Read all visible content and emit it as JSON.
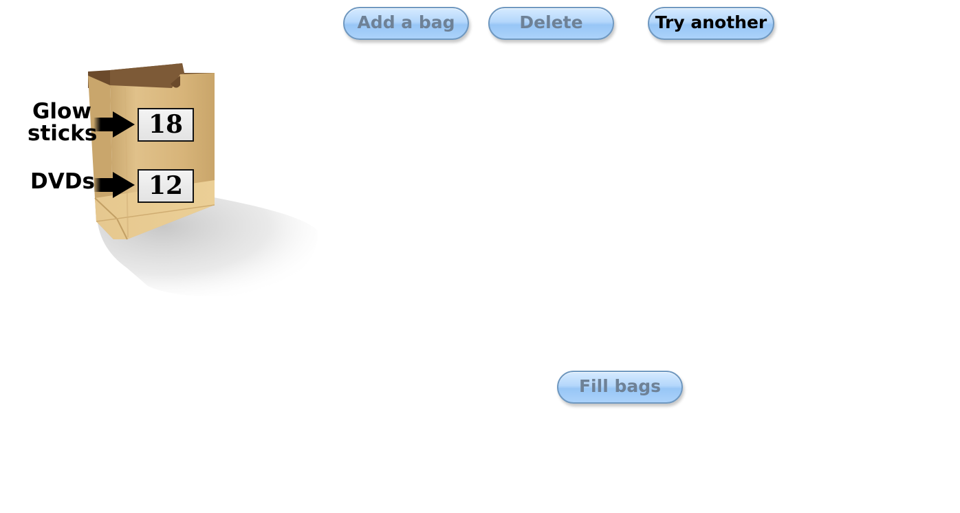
{
  "toolbar": {
    "add_label": "Add a bag",
    "delete_label": "Delete",
    "try_label": "Try another"
  },
  "bag": {
    "items": [
      {
        "label_line1": "Glow",
        "label_line2": "sticks",
        "count": "18"
      },
      {
        "label": "DVDs",
        "count": "12"
      }
    ],
    "colors": {
      "bag_front": "#d9b77a",
      "bag_side": "#c9a66c",
      "bag_inner": "#6b4a2b",
      "arrow": "#000000"
    }
  },
  "actions": {
    "fill_label": "Fill bags"
  },
  "colors": {
    "button_fill": "#b4d7fb",
    "button_border": "#6f98c0",
    "disabled_text": "#6e8196",
    "enabled_text": "#000000"
  },
  "icons": [
    "paper-bag-icon",
    "right-arrow-icon"
  ]
}
